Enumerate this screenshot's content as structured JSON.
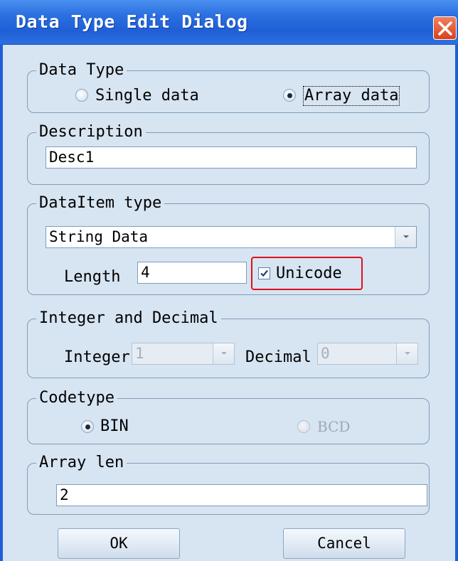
{
  "window": {
    "title": "Data Type Edit Dialog"
  },
  "data_type": {
    "legend": "Data Type",
    "options": [
      "Single data",
      "Array data"
    ],
    "selected": "Array data"
  },
  "description": {
    "legend": "Description",
    "value": "Desc1"
  },
  "dataitem_type": {
    "legend": "DataItem type",
    "selected": "String Data",
    "length_label": "Length",
    "length_value": "4",
    "unicode_label": "Unicode",
    "unicode_checked": true
  },
  "integer_decimal": {
    "legend": "Integer and Decimal",
    "integer_label": "Integer",
    "integer_value": "1",
    "decimal_label": "Decimal",
    "decimal_value": "0"
  },
  "codetype": {
    "legend": "Codetype",
    "options": [
      "BIN",
      "BCD"
    ],
    "selected": "BIN"
  },
  "array_len": {
    "legend": "Array len",
    "value": "2"
  },
  "buttons": {
    "ok": "OK",
    "cancel": "Cancel"
  },
  "colors": {
    "titlebar": "#2b6fe0",
    "background": "#d7e4f2",
    "highlight": "#e0101a"
  }
}
